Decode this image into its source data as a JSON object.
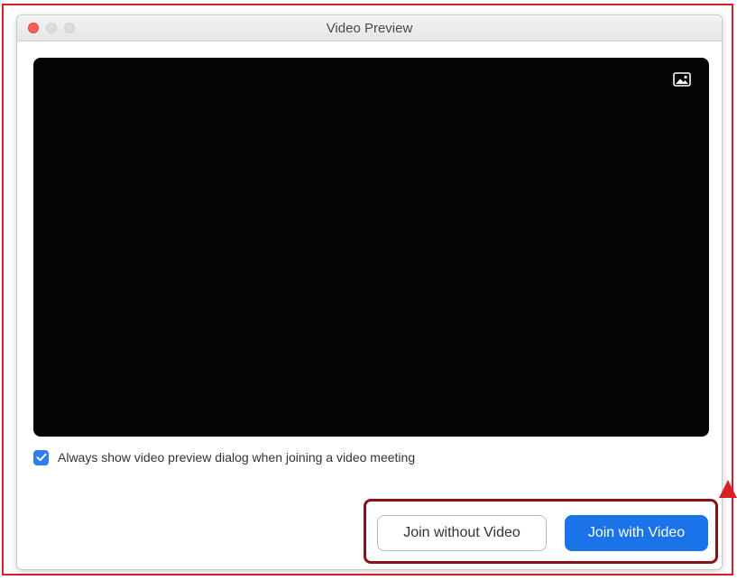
{
  "window": {
    "title": "Video Preview"
  },
  "video_preview": {
    "icon": "image-icon",
    "background_color": "#050505"
  },
  "options": {
    "always_show_preview": {
      "label": "Always show video preview dialog when joining a video meeting",
      "checked": true
    }
  },
  "actions": {
    "join_without_video_label": "Join without Video",
    "join_with_video_label": "Join with Video"
  },
  "colors": {
    "accent_blue": "#1a73e8",
    "annotation_red": "#d61f26",
    "highlight_dark_red": "#8a1117"
  }
}
